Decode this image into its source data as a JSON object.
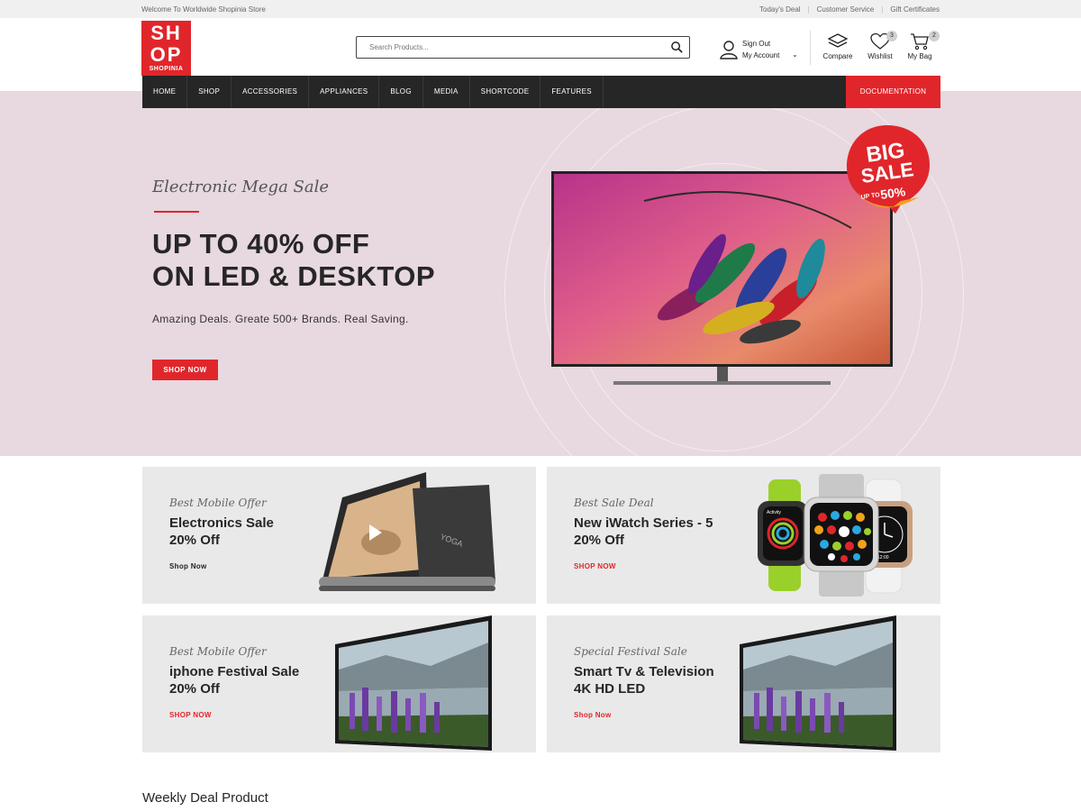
{
  "topbar": {
    "welcome": "Welcome To Worldwide Shopinia Store",
    "links": [
      "Today's Deal",
      "Customer Service",
      "Gift Certificates"
    ]
  },
  "logo": {
    "line1": "SH",
    "line2": "OP",
    "line3": "SHOPINIA"
  },
  "search": {
    "placeholder": "Search Products..."
  },
  "account": {
    "line1": "Sign Out",
    "line2": "My Account"
  },
  "header_actions": {
    "compare": {
      "label": "Compare"
    },
    "wishlist": {
      "label": "Wishlist",
      "count": "3"
    },
    "bag": {
      "label": "My Bag",
      "count": "2"
    }
  },
  "nav": {
    "items": [
      "HOME",
      "SHOP",
      "ACCESSORIES",
      "APPLIANCES",
      "BLOG",
      "MEDIA",
      "SHORTCODE",
      "FEATURES"
    ],
    "documentation": "DOCUMENTATION"
  },
  "hero": {
    "tagline": "Electronic Mega Sale",
    "headline_1": "UP TO 40% OFF",
    "headline_2": "ON LED & DESKTOP",
    "subtext": "Amazing Deals. Greate 500+ Brands. Real Saving.",
    "button": "SHOP NOW",
    "badge_1": "BIG",
    "badge_2": "SALE",
    "badge_3": "UP TO",
    "badge_4": "50%"
  },
  "cards": [
    {
      "tag": "Best Mobile Offer",
      "title_1": "Electronics Sale",
      "title_2": "20% Off",
      "link": "Shop Now"
    },
    {
      "tag": "Best Sale Deal",
      "title_1": "New iWatch Series - 5",
      "title_2": "20% Off",
      "link": "SHOP NOW"
    },
    {
      "tag": "Best Mobile Offer",
      "title_1": "iphone Festival Sale",
      "title_2": "20% Off",
      "link": "SHOP NOW"
    },
    {
      "tag": "Special Festival Sale",
      "title_1": "Smart Tv & Television",
      "title_2": "4K HD LED",
      "link": "Shop Now"
    }
  ],
  "tablet_brand": "YOGA",
  "watch_labels": [
    "Activity",
    "12:00"
  ],
  "section_title": "Weekly Deal Product"
}
